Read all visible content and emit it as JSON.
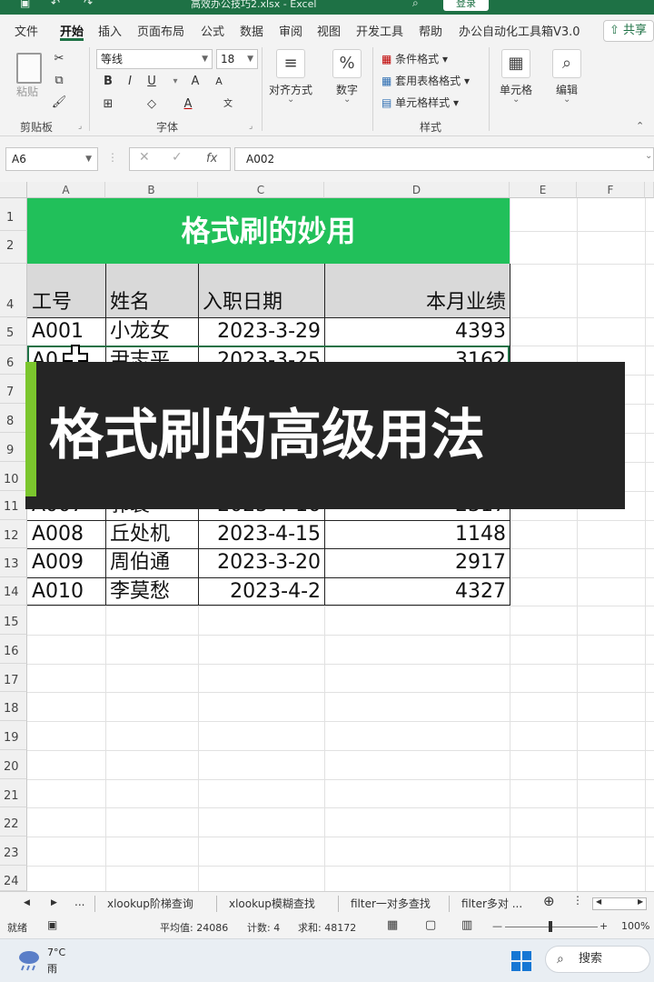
{
  "titlebar": {
    "file_title": "高效办公技巧2.xlsx  -  Excel",
    "login": "登录"
  },
  "menu": {
    "tabs": [
      "文件",
      "开始",
      "插入",
      "页面布局",
      "公式",
      "数据",
      "审阅",
      "视图",
      "开发工具",
      "帮助",
      "办公自动化工具箱V3.0"
    ],
    "share": "共享"
  },
  "ribbon": {
    "paste": "粘贴",
    "clipboard": "剪贴板",
    "font_name": "等线",
    "font_size": "18",
    "font_group": "字体",
    "bold": "B",
    "italic": "I",
    "underline": "U",
    "grow": "A",
    "shrink": "A",
    "align": "对齐方式",
    "number": "数字",
    "cond_format": "条件格式",
    "table_format": "套用表格格式",
    "cell_style": "单元格样式",
    "styles": "样式",
    "cells": "单元格",
    "editing": "编辑"
  },
  "formula_bar": {
    "name_box": "A6",
    "fx": "fx",
    "content": "A002"
  },
  "columns": [
    "A",
    "B",
    "C",
    "D",
    "E",
    "F"
  ],
  "rows": [
    "1",
    "2",
    "4",
    "5",
    "6",
    "7",
    "8",
    "9",
    "10",
    "11",
    "12",
    "13",
    "14",
    "15",
    "16",
    "17",
    "18",
    "19",
    "20",
    "21",
    "22",
    "23",
    "24"
  ],
  "sheet": {
    "banner": "格式刷的妙用",
    "headers": [
      "工号",
      "姓名",
      "入职日期",
      "本月业绩"
    ],
    "data": [
      [
        "A001",
        "小龙女",
        "2023-3-29",
        "4393"
      ],
      [
        "A008",
        "丘处机",
        "2023-4-15",
        "1148"
      ],
      [
        "A009",
        "周伯通",
        "2023-3-20",
        "2917"
      ],
      [
        "A010",
        "李莫愁",
        "2023-4-2",
        "4327"
      ]
    ],
    "partial_row6": [
      "A0",
      "尹志平",
      "2023-3-25",
      "3162"
    ],
    "partial_row11": [
      "A007",
      "郭襄",
      "2023-4-16",
      "2317"
    ]
  },
  "overlay": {
    "title": "格式刷的高级用法"
  },
  "sheet_tabs": {
    "items": [
      "xlookup阶梯查询",
      "xlookup模糊查找",
      "filter一对多查找",
      "filter多对 ..."
    ],
    "more": "..."
  },
  "status": {
    "ready": "就绪",
    "average": "平均值: 24086",
    "count": "计数: 4",
    "sum": "求和: 48172",
    "zoom": "100%"
  },
  "taskbar": {
    "weather_temp": "7°C",
    "weather_desc": "雨",
    "search": "搜索"
  },
  "colors": {
    "excel_green": "#1e7145",
    "banner_green": "#21c05a",
    "overlay_bg": "#252525",
    "accent": "#7bc62d"
  }
}
